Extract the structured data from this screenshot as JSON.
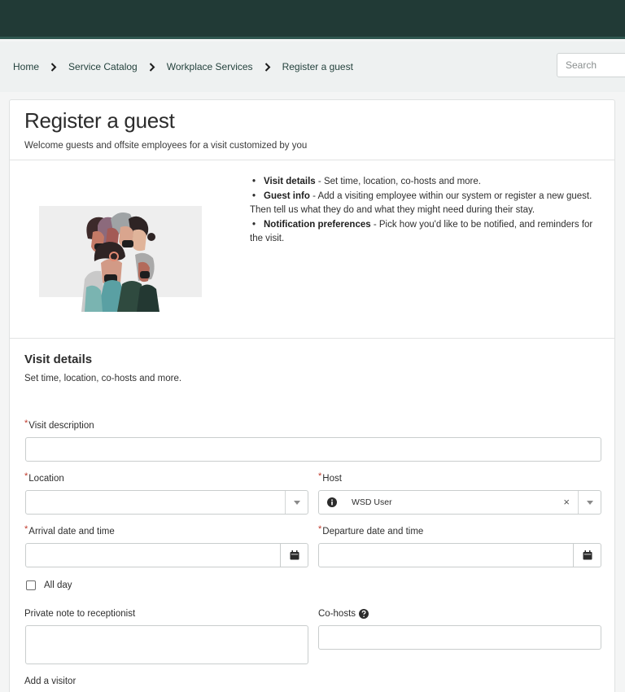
{
  "breadcrumb": {
    "items": [
      "Home",
      "Service Catalog",
      "Workplace Services",
      "Register a guest"
    ]
  },
  "search": {
    "placeholder": "Search"
  },
  "page": {
    "title": "Register a guest",
    "subtitle": "Welcome guests and offsite employees for a visit customized by you"
  },
  "intro": {
    "items": [
      {
        "title": "Visit details",
        "text": " - Set time, location, co-hosts and more."
      },
      {
        "title": "Guest info",
        "text": " - Add a visiting employee within our system or register a new guest. Then tell us what they do and what they might need during their stay."
      },
      {
        "title": "Notification preferences",
        "text": " - Pick how you'd like to be notified, and reminders for the visit."
      }
    ]
  },
  "section": {
    "title": "Visit details",
    "subtitle": "Set time, location, co-hosts and more."
  },
  "form": {
    "required_mark": "*",
    "visit_description_label": "Visit description",
    "location_label": "Location",
    "host_label": "Host",
    "host_value": "WSD User",
    "arrival_label": "Arrival date and time",
    "departure_label": "Departure date and time",
    "all_day_label": "All day",
    "private_note_label": "Private note to receptionist",
    "cohosts_label": "Co-hosts",
    "add_visitor_label": "Add a visitor"
  },
  "colors": {
    "topbar": "#213a36",
    "breadcrumb_bg": "#eef1f1",
    "required": "#c0392b"
  },
  "icons": [
    "chevron-right-icon",
    "chevron-down-icon",
    "calendar-icon",
    "info-icon",
    "clear-icon",
    "help-icon"
  ]
}
